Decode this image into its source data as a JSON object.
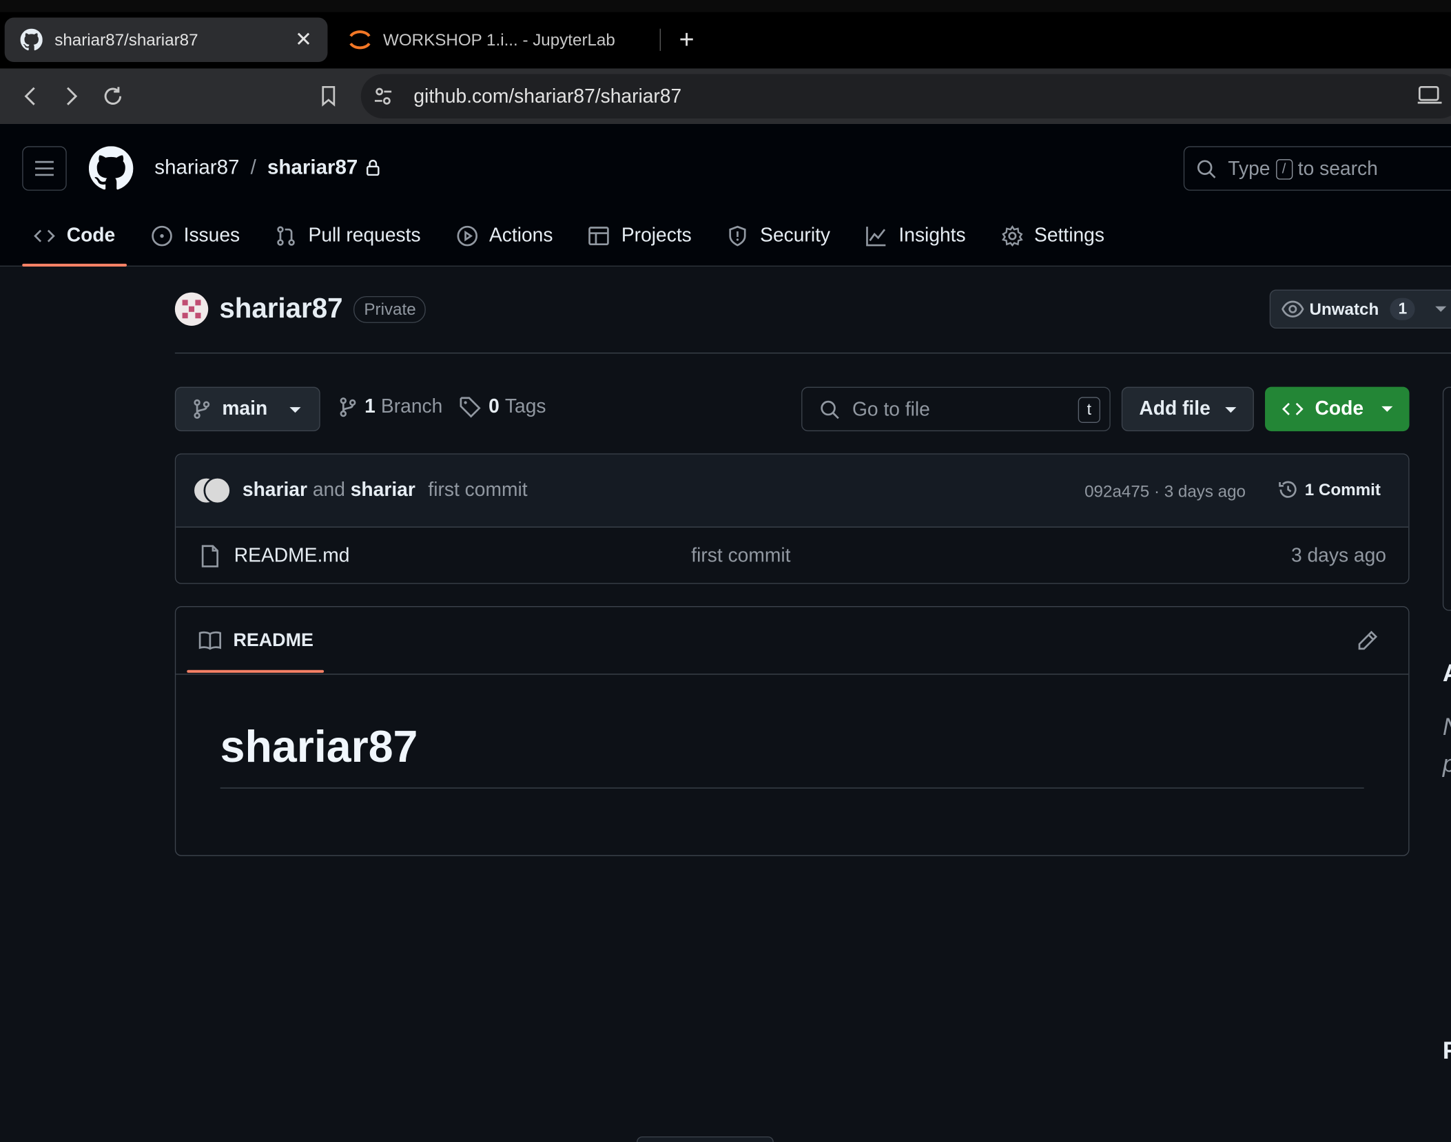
{
  "browser": {
    "tabs": [
      {
        "title": "shariar87/shariar87",
        "active": true
      },
      {
        "title": "WORKSHOP 1.i... - JupyterLab",
        "active": false
      }
    ],
    "url": "github.com/shariar87/shariar87"
  },
  "header": {
    "owner": "shariar87",
    "separator": "/",
    "repo": "shariar87",
    "search_prefix": "Type",
    "search_key": "/",
    "search_suffix": "to search"
  },
  "repo_nav": {
    "items": [
      {
        "label": "Code",
        "icon": "code-icon",
        "active": true
      },
      {
        "label": "Issues",
        "icon": "issue-icon"
      },
      {
        "label": "Pull requests",
        "icon": "pull-request-icon"
      },
      {
        "label": "Actions",
        "icon": "play-icon"
      },
      {
        "label": "Projects",
        "icon": "table-icon"
      },
      {
        "label": "Security",
        "icon": "shield-icon"
      },
      {
        "label": "Insights",
        "icon": "graph-icon"
      },
      {
        "label": "Settings",
        "icon": "gear-icon"
      }
    ]
  },
  "repo": {
    "name": "shariar87",
    "visibility": "Private",
    "watch_label": "Unwatch",
    "watch_count": "1"
  },
  "file_nav": {
    "branch": "main",
    "branch_count": "1",
    "branch_label": "Branch",
    "tag_count": "0",
    "tag_label": "Tags",
    "goto_placeholder": "Go to file",
    "goto_key": "t",
    "add_file": "Add file",
    "code": "Code"
  },
  "commit": {
    "author1": "shariar",
    "joiner": "and",
    "author2": "shariar",
    "message": "first commit",
    "hash_age": "092a475 · 3 days ago",
    "count_label": "1 Commit"
  },
  "files": [
    {
      "name": "README.md",
      "message": "first commit",
      "date": "3 days ago"
    }
  ],
  "readme": {
    "tab_label": "README",
    "heading": "shariar87"
  },
  "colors": {
    "background": "#0d1117",
    "header": "#010409",
    "accent_underline": "#f78166",
    "code_button": "#238636"
  }
}
